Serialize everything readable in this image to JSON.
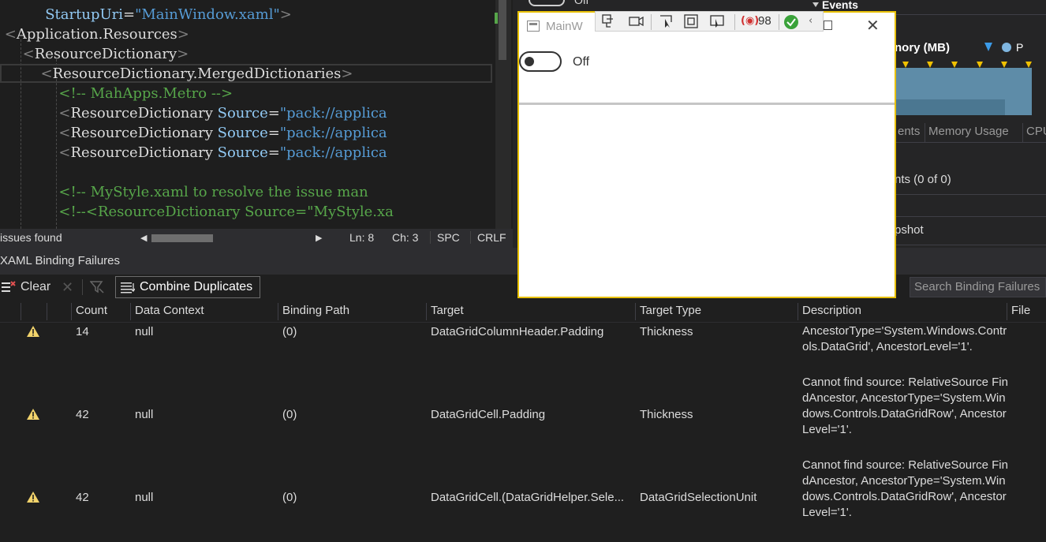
{
  "editor": {
    "lines": [
      {
        "indent": "          ",
        "parts": [
          {
            "c": "attr",
            "t": "StartupUri"
          },
          {
            "c": "tag-n",
            "t": "="
          },
          {
            "c": "strv",
            "t": "\"MainWindow.xaml\""
          },
          {
            "c": "tag-b",
            "t": ">"
          }
        ]
      },
      {
        "indent": " ",
        "parts": [
          {
            "c": "tag-b",
            "t": "<"
          },
          {
            "c": "tag-n",
            "t": "Application.Resources"
          },
          {
            "c": "tag-b",
            "t": ">"
          }
        ]
      },
      {
        "indent": "     ",
        "parts": [
          {
            "c": "tag-b",
            "t": "<"
          },
          {
            "c": "tag-n",
            "t": "ResourceDictionary"
          },
          {
            "c": "tag-b",
            "t": ">"
          }
        ]
      },
      {
        "indent": "         ",
        "parts": [
          {
            "c": "tag-b",
            "t": "<"
          },
          {
            "c": "tag-n",
            "t": "ResourceDictionary.MergedDictionaries"
          },
          {
            "c": "tag-b",
            "t": ">"
          }
        ]
      },
      {
        "indent": "             ",
        "parts": [
          {
            "c": "cmt",
            "t": "<!-- MahApps.Metro -->"
          }
        ]
      },
      {
        "indent": "             ",
        "parts": [
          {
            "c": "tag-b",
            "t": "<"
          },
          {
            "c": "tag-n",
            "t": "ResourceDictionary "
          },
          {
            "c": "attr",
            "t": "Source"
          },
          {
            "c": "tag-n",
            "t": "="
          },
          {
            "c": "strv",
            "t": "\"pack://applica"
          }
        ]
      },
      {
        "indent": "             ",
        "parts": [
          {
            "c": "tag-b",
            "t": "<"
          },
          {
            "c": "tag-n",
            "t": "ResourceDictionary "
          },
          {
            "c": "attr",
            "t": "Source"
          },
          {
            "c": "tag-n",
            "t": "="
          },
          {
            "c": "strv",
            "t": "\"pack://applica"
          }
        ]
      },
      {
        "indent": "             ",
        "parts": [
          {
            "c": "tag-b",
            "t": "<"
          },
          {
            "c": "tag-n",
            "t": "ResourceDictionary "
          },
          {
            "c": "attr",
            "t": "Source"
          },
          {
            "c": "tag-n",
            "t": "="
          },
          {
            "c": "strv",
            "t": "\"pack://applica"
          }
        ]
      },
      {
        "indent": "",
        "parts": []
      },
      {
        "indent": "             ",
        "parts": [
          {
            "c": "cmt",
            "t": "<!-- MyStyle.xaml to resolve the issue man"
          }
        ]
      },
      {
        "indent": "             ",
        "parts": [
          {
            "c": "cmt",
            "t": "<!--<ResourceDictionary Source=\"MyStyle.xa"
          }
        ]
      }
    ]
  },
  "statusbar": {
    "issues": "issues found",
    "line": "Ln: 8",
    "col": "Ch: 3",
    "spacing": "SPC",
    "eol": "CRLF"
  },
  "diagnostics": {
    "events_title": "Events",
    "memory_label": "nory (MB)",
    "legend_p": "P",
    "tabs": [
      "ents",
      "Memory Usage",
      "CPU"
    ],
    "row1": "nts (0 of 0)",
    "row2": "pshot"
  },
  "panel": {
    "title": "XAML Binding Failures",
    "clear_label": "Clear",
    "combine_label": "Combine Duplicates",
    "search_placeholder": "Search Binding Failures"
  },
  "grid": {
    "headers": {
      "count": "Count",
      "data_context": "Data Context",
      "binding_path": "Binding Path",
      "target": "Target",
      "target_type": "Target Type",
      "description": "Description",
      "file": "File"
    },
    "rows": [
      {
        "count": "14",
        "data_context": "null",
        "binding_path": "(0)",
        "target": "DataGridColumnHeader.Padding",
        "target_type": "Thickness",
        "description": "AncestorType='System.Windows.Controls.DataGrid', AncestorLevel='1'."
      },
      {
        "count": "42",
        "data_context": "null",
        "binding_path": "(0)",
        "target": "DataGridCell.Padding",
        "target_type": "Thickness",
        "description": "Cannot find source: RelativeSource FindAncestor, AncestorType='System.Windows.Controls.DataGridRow', AncestorLevel='1'."
      },
      {
        "count": "42",
        "data_context": "null",
        "binding_path": "(0)",
        "target": "DataGridCell.(DataGridHelper.Sele...",
        "target_type": "DataGridSelectionUnit",
        "description": "Cannot find source: RelativeSource FindAncestor, AncestorType='System.Windows.Controls.DataGridRow', AncestorLevel='1'."
      }
    ]
  },
  "app_window": {
    "title": "MainW",
    "toggle_label": "Off",
    "hot_reload_count": "98",
    "behind_toggle_label": "Off"
  }
}
